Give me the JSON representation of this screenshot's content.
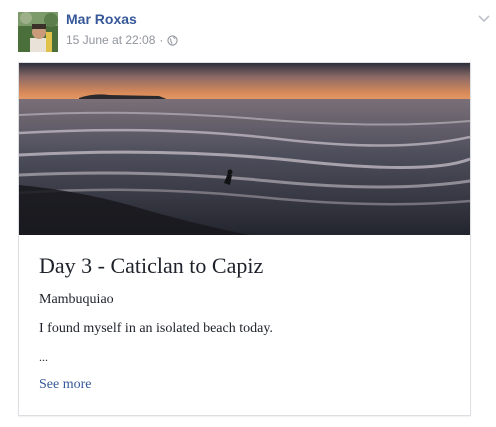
{
  "post": {
    "author": "Mar Roxas",
    "timestamp": "15 June at 22:08",
    "separator": "·",
    "privacy_icon": "globe-icon",
    "menu_icon": "chevron-down-icon"
  },
  "card": {
    "image": "sunset-beach-photo",
    "title": "Day 3 - Caticlan to Capiz",
    "lines": [
      "Mambuquiao",
      "I found myself in an isolated beach today."
    ],
    "ellipsis": "...",
    "see_more": "See more"
  },
  "colors": {
    "link": "#365899",
    "meta": "#90949c",
    "text": "#1d2129",
    "border": "#dddfe2"
  }
}
